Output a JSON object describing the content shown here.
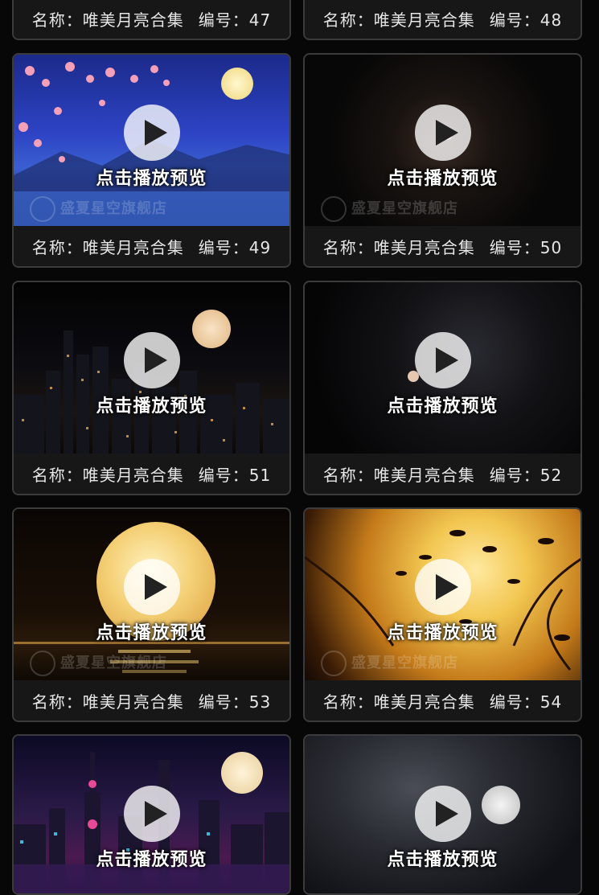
{
  "top_captions": [
    {
      "name_label": "名称：唯美月亮合集",
      "number_label": "编号：47"
    },
    {
      "name_label": "名称：唯美月亮合集",
      "number_label": "编号：48"
    }
  ],
  "cards": [
    {
      "name_label": "名称：唯美月亮合集",
      "number_label": "编号：49",
      "preview": "点击播放预览",
      "watermark": "盛夏星空旗舰店"
    },
    {
      "name_label": "名称：唯美月亮合集",
      "number_label": "编号：50",
      "preview": "点击播放预览",
      "watermark": "盛夏星空旗舰店"
    },
    {
      "name_label": "名称：唯美月亮合集",
      "number_label": "编号：51",
      "preview": "点击播放预览",
      "watermark": ""
    },
    {
      "name_label": "名称：唯美月亮合集",
      "number_label": "编号：52",
      "preview": "点击播放预览",
      "watermark": ""
    },
    {
      "name_label": "名称：唯美月亮合集",
      "number_label": "编号：53",
      "preview": "点击播放预览",
      "watermark": "盛夏星空旗舰店"
    },
    {
      "name_label": "名称：唯美月亮合集",
      "number_label": "编号：54",
      "preview": "点击播放预览",
      "watermark": "盛夏星空旗舰店"
    },
    {
      "preview": "点击播放预览"
    },
    {
      "preview": "点击播放预览"
    }
  ],
  "colors": {
    "card_border": "#3b3b3b",
    "caption_bg": "#171717",
    "text": "#e6e6e6"
  },
  "icons": {
    "play": "play-icon"
  }
}
